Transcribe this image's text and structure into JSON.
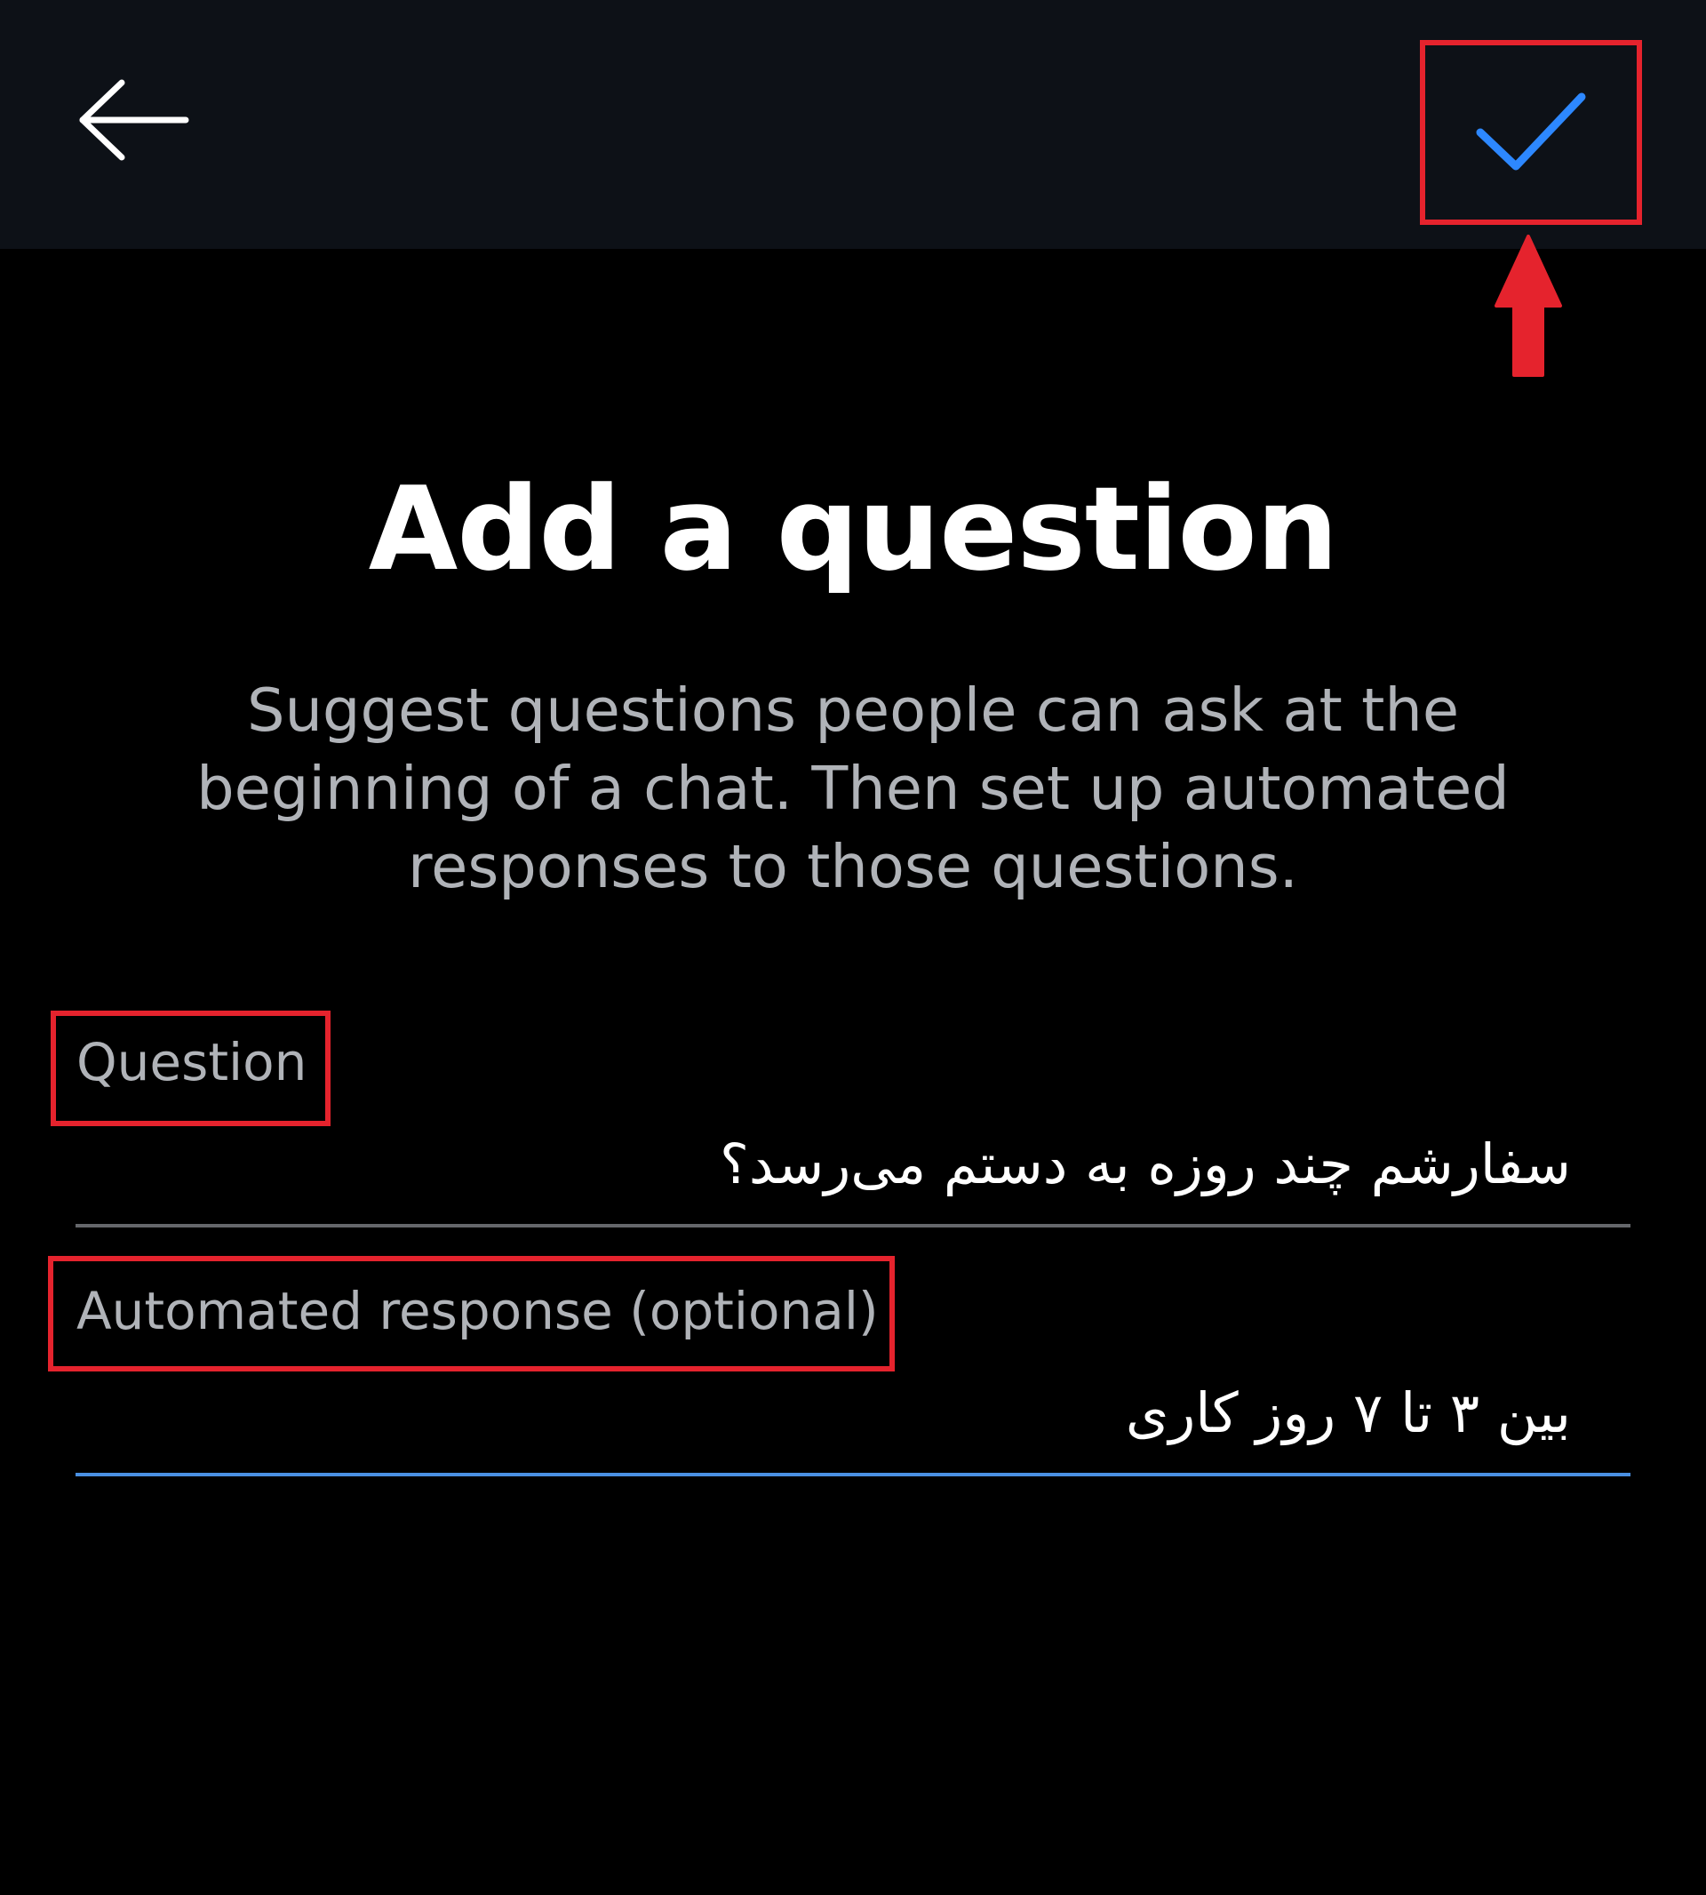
{
  "header": {
    "back_icon": "arrow-left-icon",
    "done_icon": "checkmark-icon",
    "background": "#0d1117",
    "checkmark_color": "#2d88ff"
  },
  "main": {
    "title": "Add a question",
    "description": "Suggest questions people can ask at the beginning of a chat. Then set up automated responses to those questions."
  },
  "form": {
    "question_label": "Question",
    "question_value": "سفارشم چند روزه به دستم می‌رسد؟",
    "response_label": "Automated response (optional)",
    "response_value": "بین ۳ تا ۷ روز کاری"
  },
  "colors": {
    "annotation_red": "#e5232d",
    "inactive_underline": "#65676b",
    "focused_underline": "#4a90e2",
    "label_gray": "#b0b3b8"
  }
}
